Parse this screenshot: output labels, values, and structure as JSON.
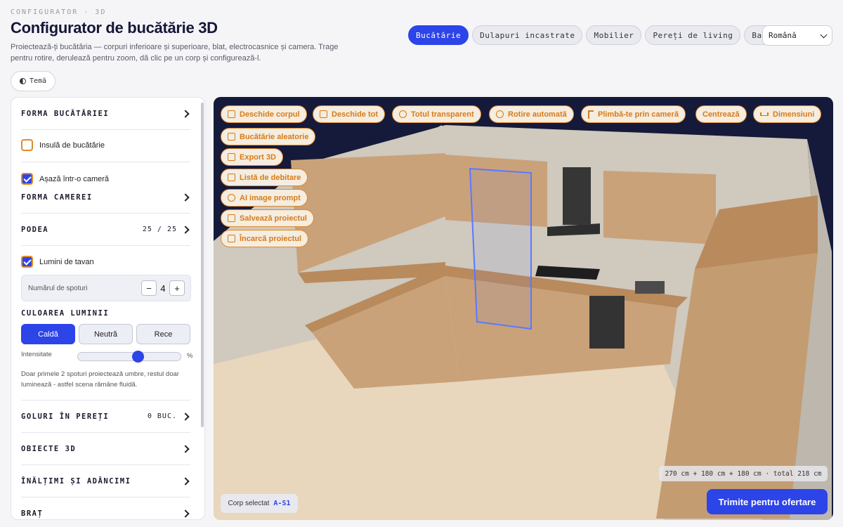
{
  "header": {
    "eyebrow": "CONFIGURATOR · 3D",
    "title": "Configurator de bucătărie 3D",
    "subtitle": "Proiectează-ți bucătăria — corpuri inferioare și superioare, blat, electrocasnice și camera. Trage pentru rotire, derulează pentru zoom, dă clic pe un corp și configurează-l.",
    "theme_label": "Temă"
  },
  "nav": {
    "tabs": [
      {
        "label": "Bucătărie",
        "active": true
      },
      {
        "label": "Dulapuri incastrate",
        "active": false
      },
      {
        "label": "Mobilier",
        "active": false
      },
      {
        "label": "Pereți de living",
        "active": false
      },
      {
        "label": "Baie",
        "active": false
      }
    ],
    "language": "Română"
  },
  "sidebar": {
    "kitchen_shape": "FORMA BUCĂTĂRIEI",
    "island": {
      "label": "Insulă de bucătărie",
      "checked": false
    },
    "place_in_room": {
      "label": "Așază într-o cameră",
      "checked": true
    },
    "room_shape": "FORMA CAMEREI",
    "floor": {
      "label": "PODEA",
      "value": "25 / 25"
    },
    "ceiling_lights": {
      "label": "Lumini de tavan",
      "checked": true
    },
    "spots": {
      "label": "Numărul de spoturi",
      "value": "4",
      "minus": "−",
      "plus": "+"
    },
    "light_color": {
      "label": "CULOAREA LUMINII",
      "options": [
        {
          "label": "Caldă",
          "active": true
        },
        {
          "label": "Neutră",
          "active": false
        },
        {
          "label": "Rece",
          "active": false
        }
      ]
    },
    "intensity": {
      "label": "Intensitate",
      "unit": "%",
      "value": 0.59
    },
    "note": "Doar primele 2 spoturi proiectează umbre, restul doar luminează - astfel scena rămâne fluidă.",
    "wall_openings": {
      "label": "GOLURI ÎN PEREȚI",
      "value": "0 BUC."
    },
    "objects_3d": "OBIECTE 3D",
    "heights_depths": "ÎNĂLȚIMI ȘI ADÂNCIMI",
    "arm": "BRAȚ"
  },
  "toolbar": {
    "row1": [
      {
        "label": "Deschide corpul",
        "icon": "door-icon"
      },
      {
        "label": "Deschide tot",
        "icon": "doors-icon"
      },
      {
        "label": "Totul transparent",
        "icon": "eye-icon"
      },
      {
        "label": "Rotire automată",
        "icon": "rotate-icon"
      },
      {
        "label": "Plimbă-te prin cameră",
        "icon": "walk-icon"
      },
      {
        "label": "Centrează",
        "icon": ""
      },
      {
        "label": "Dimensiuni",
        "icon": "ruler-icon"
      }
    ],
    "stack": [
      {
        "label": "Bucătărie aleatorie",
        "icon": "dice-icon"
      },
      {
        "label": "Export 3D",
        "icon": "download-icon"
      },
      {
        "label": "Listă de debitare",
        "icon": "list-icon"
      },
      {
        "label": "AI image prompt",
        "icon": "sparkle-icon"
      },
      {
        "label": "Salvează proiectul",
        "icon": "save-icon"
      },
      {
        "label": "Încarcă proiectul",
        "icon": "upload-icon"
      }
    ]
  },
  "viewport": {
    "dimensions": "270 cm + 180 cm + 180 cm · total 218 cm",
    "selected_label": "Corp selectat",
    "selected_code": "A-S1",
    "cta": "Trimite pentru ofertare"
  },
  "colors": {
    "accent": "#2c44e8",
    "toolbar_orange": "#d97a18",
    "viewport_bg": "#15193a",
    "wood": "#c9a27a",
    "floor": "#e8d6bd"
  }
}
